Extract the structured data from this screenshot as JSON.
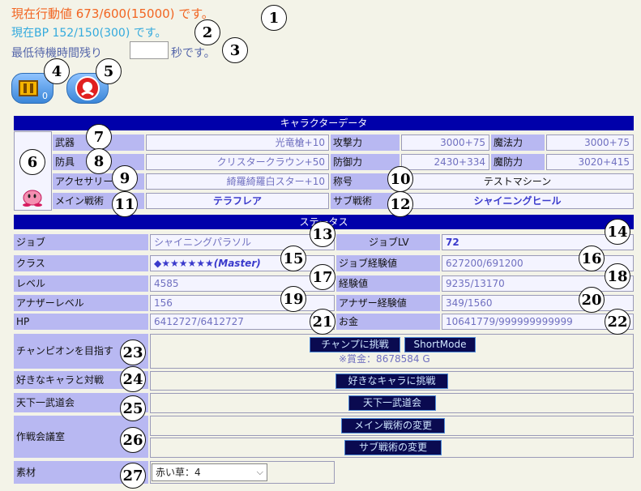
{
  "status": {
    "action_text": "現在行動値 673/600(15000) です。",
    "bp_text": "現在BP 152/150(300) です。",
    "wait_prefix": "最低待機時間残り",
    "wait_suffix": "秒です。"
  },
  "icons": {
    "chest_count": "0",
    "chest_icon": "treasure-chest-icon",
    "avatar_icon": "red-face-icon"
  },
  "character": {
    "header": "キャラクターデータ",
    "weapon_label": "武器",
    "weapon_value": "光竜槍+10",
    "armor_label": "防具",
    "armor_value": "クリスタークラウン+50",
    "accessory_label": "アクセサリー",
    "accessory_value": "綺羅綺羅白スター+10",
    "main_tactic_label": "メイン戦術",
    "main_tactic_value": "テラフレア",
    "attack_label": "攻撃力",
    "attack_value": "3000+75",
    "magic_label": "魔法力",
    "magic_value": "3000+75",
    "defense_label": "防御力",
    "defense_value": "2430+334",
    "mdefense_label": "魔防力",
    "mdefense_value": "3020+415",
    "title_label": "称号",
    "title_value": "テストマシーン",
    "sub_tactic_label": "サブ戦術",
    "sub_tactic_value": "シャイニングヒール"
  },
  "stats": {
    "header": "ステータス",
    "job_label": "ジョブ",
    "job_value": "シャイニングパラソル",
    "joblv_label": "ジョブLV",
    "joblv_value": "72",
    "class_label": "クラス",
    "class_value": "◆★★★★★★(Master)",
    "jobexp_label": "ジョブ経験値",
    "jobexp_value": "627200/691200",
    "level_label": "レベル",
    "level_value": "4585",
    "exp_label": "経験値",
    "exp_value": "9235/13170",
    "another_level_label": "アナザーレベル",
    "another_level_value": "156",
    "another_exp_label": "アナザー経験値",
    "another_exp_value": "349/1560",
    "hp_label": "HP",
    "hp_value": "6412727/6412727",
    "money_label": "お金",
    "money_value": "10641779/999999999999"
  },
  "actions": {
    "champion_label": "チャンピオンを目指す",
    "champion_button": "チャンプに挑戦",
    "shortmode_button": "ShortMode",
    "prize_text": "※賞金：8678584 G",
    "favorite_label": "好きなキャラと対戦",
    "favorite_button": "好きなキャラに挑戦",
    "tournament_label": "天下一武道会",
    "tournament_button": "天下一武道会",
    "strategy_label": "作戦会議室",
    "main_change_button": "メイン戦術の変更",
    "sub_change_button": "サブ戦術の変更",
    "material_label": "素材",
    "material_selected": "赤い草：4"
  },
  "markers": [
    "1",
    "2",
    "3",
    "4",
    "5",
    "6",
    "7",
    "8",
    "9",
    "10",
    "11",
    "12",
    "13",
    "14",
    "15",
    "16",
    "17",
    "18",
    "19",
    "20",
    "21",
    "22",
    "23",
    "24",
    "25",
    "26",
    "27"
  ]
}
